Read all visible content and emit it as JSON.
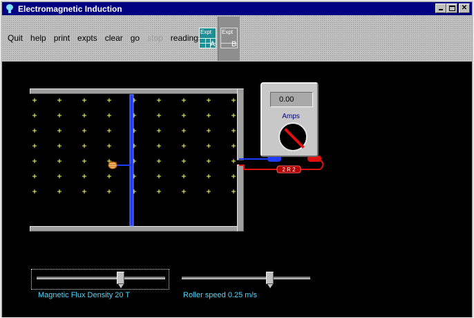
{
  "window": {
    "title": "Electromagnetic Induction"
  },
  "menu": {
    "quit": "Quit",
    "help": "help",
    "print": "print",
    "expts": "expts",
    "clear": "clear",
    "go": "go",
    "stop": "stop",
    "readings": "readings"
  },
  "experiments": {
    "a": {
      "title": "Expt",
      "label": "A"
    },
    "b": {
      "title": "Expt",
      "label": "B"
    }
  },
  "ammeter": {
    "reading": "0.00",
    "unit_label": "Amps"
  },
  "resistor": {
    "label": "2 R 2"
  },
  "sliders": {
    "flux": {
      "label": "Magnetic Flux Density 20 T",
      "position_fraction": 0.66
    },
    "speed": {
      "label": "Roller speed 0.25 m/s",
      "position_fraction": 0.7
    }
  },
  "colors": {
    "field_marker": "#ffff66",
    "rod": "#1f3bff",
    "label_text": "#4fd9ff",
    "red_lead": "#e01010",
    "blue_lead": "#1f3bff",
    "title_bar": "#000080"
  },
  "icons": {
    "app": "lightbulb-icon",
    "hand": "hand-icon"
  }
}
